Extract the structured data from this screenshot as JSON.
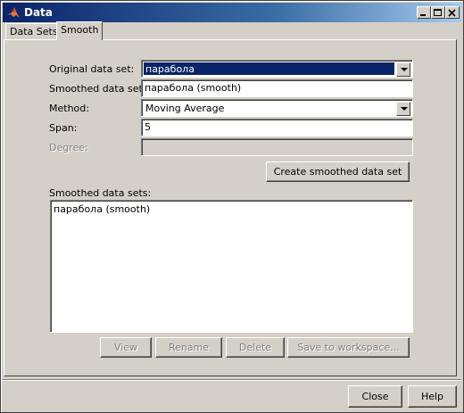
{
  "window": {
    "title": "Data"
  },
  "tabs": [
    {
      "label": "Data Sets",
      "active": false
    },
    {
      "label": "Smooth",
      "active": true
    }
  ],
  "form": {
    "original_label": "Original data set:",
    "original_value": "парабола",
    "smoothed_label": "Smoothed data set:",
    "smoothed_value": "парабола (smooth)",
    "method_label": "Method:",
    "method_value": "Moving Average",
    "span_label": "Span:",
    "span_value": "5",
    "degree_label": "Degree:",
    "degree_value": ""
  },
  "create_button": "Create smoothed data set",
  "list": {
    "label": "Smoothed data sets:",
    "items": [
      "парабола (smooth)"
    ]
  },
  "actions": {
    "view": "View",
    "rename": "Rename",
    "delete": "Delete",
    "save": "Save to workspace..."
  },
  "footer": {
    "close": "Close",
    "help": "Help"
  },
  "colors": {
    "title_bar": "#0a246a",
    "selection": "#0a246a",
    "face": "#d4d0c8"
  }
}
